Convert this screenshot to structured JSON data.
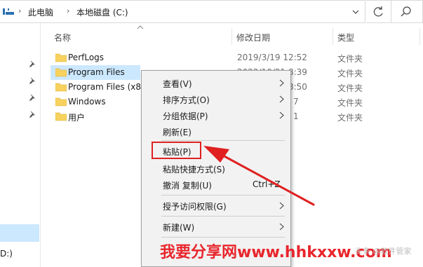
{
  "address_bar": {
    "crumbs": [
      "此电脑",
      "本地磁盘 (C:)"
    ]
  },
  "columns": {
    "name": "名称",
    "date": "修改日期",
    "type": "类型"
  },
  "files": [
    {
      "name": "PerfLogs",
      "date": "2019/3/19 12:52",
      "type": "文件夹"
    },
    {
      "name": "Program Files",
      "date": "2022/10/21 8:39",
      "type": "文件夹"
    },
    {
      "name": "Program Files (x86)",
      "date": "2022/10/21 8:50",
      "type": "文件夹"
    },
    {
      "name": "Windows",
      "date": "7",
      "type": "文件夹"
    },
    {
      "name": "用户",
      "date": "1",
      "type": "文件夹"
    }
  ],
  "nav": {
    "drive_label": "D:)"
  },
  "context_menu": {
    "view": "查看(V)",
    "sort": "排序方式(O)",
    "group": "分组依据(P)",
    "refresh": "刷新(E)",
    "paste": "粘贴(P)",
    "paste_shortcut": "粘贴快捷方式(S)",
    "undo": "撤消 复制(U)",
    "undo_key": "Ctrl+Z",
    "access": "授予访问权限(G)",
    "new": "新建(W)"
  },
  "watermark": {
    "text": "我要分享网www.hhkxxw.com",
    "faint": "头条 @软件管家"
  },
  "colors": {
    "selection": "#cce8ff",
    "annotation_red": "#e02020",
    "folder_yellow": "#f7d25f"
  }
}
